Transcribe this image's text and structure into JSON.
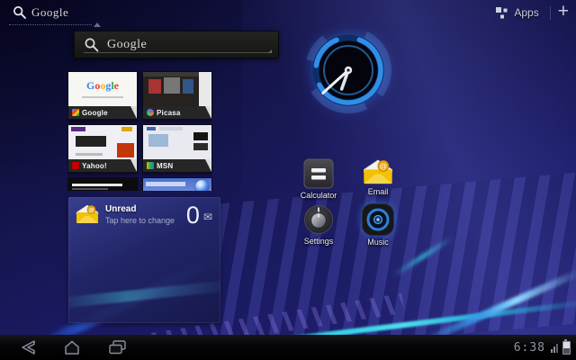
{
  "top_bar": {
    "search_label": "Google",
    "apps_label": "Apps",
    "plus_label": "+"
  },
  "search_widget": {
    "logo_text": "Google"
  },
  "bookmarks_widget": {
    "items": [
      {
        "label": "Google"
      },
      {
        "label": "Picasa"
      },
      {
        "label": "Yahoo!"
      },
      {
        "label": "MSN"
      }
    ],
    "google_logo_letters": [
      "G",
      "o",
      "o",
      "g",
      "l",
      "e"
    ]
  },
  "email_widget": {
    "title": "Unread",
    "subtitle": "Tap here to change",
    "unread_count": "0"
  },
  "app_shortcuts": [
    {
      "label": "Calculator"
    },
    {
      "label": "Email"
    },
    {
      "label": "Settings"
    },
    {
      "label": "Music"
    }
  ],
  "system_bar": {
    "time": "6:38"
  },
  "icons": {
    "mail_glyph": "✉"
  },
  "colors": {
    "accent_blue": "#2f8fe8",
    "wallpaper_base": "#14144a",
    "envelope_yellow": "#f2c200",
    "cyan_streak": "#35d0e4"
  }
}
